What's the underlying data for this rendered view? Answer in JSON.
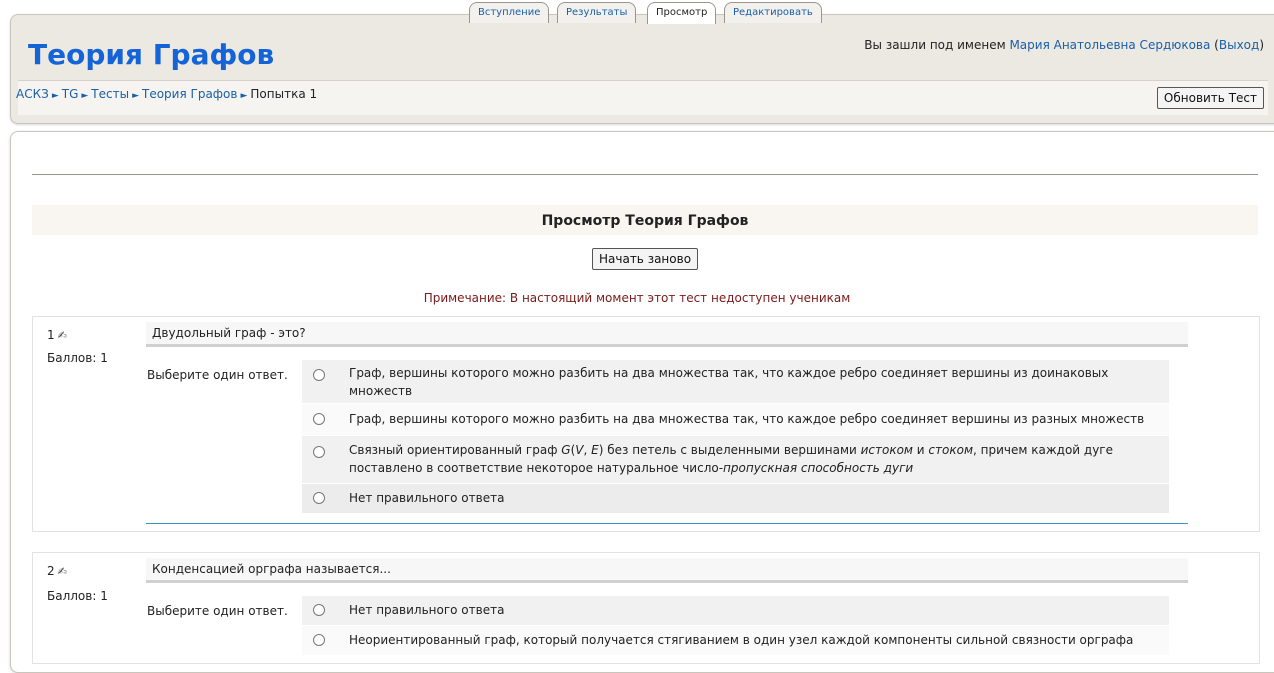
{
  "header": {
    "course_title": "Теория Графов",
    "login_prefix": "Вы зашли под именем ",
    "user_name": "Мария Анатольевна Сердюкова",
    "logout": "Выход",
    "breadcrumb": [
      "АСКЗ",
      "TG",
      "Тесты",
      "Теория Графов",
      "Попытка 1"
    ],
    "update_button": "Обновить Тест"
  },
  "tabs": [
    {
      "label": "Вступление",
      "active": false
    },
    {
      "label": "Результаты",
      "active": false
    },
    {
      "label": "Просмотр",
      "active": true
    },
    {
      "label": "Редактировать",
      "active": false
    }
  ],
  "preview": {
    "title": "Просмотр Теория Графов",
    "restart_button": "Начать заново",
    "note": "Примечание: В настоящий момент этот тест недоступен ученикам"
  },
  "questions": [
    {
      "number": "1",
      "score": "Баллов: 1",
      "text": "Двудольный граф - это?",
      "prompt": "Выберите один ответ.",
      "answers": [
        "Граф, вершины которого можно разбить на два множества так, что каждое ребро соединяет вершины из доинаковых множеств",
        "Граф, вершины которого можно разбить на два множества так, что каждое ребро соединяет вершины из разных множеств",
        "Связный ориентированный граф G(V, E) без петель с выделенными вершинами истоком и стоком, причем каждой дуге поставлено в соответствие некоторое натуральное число-пропускная способность дуги",
        "Нет правильного ответа"
      ]
    },
    {
      "number": "2",
      "score": "Баллов: 1",
      "text": "Конденсацией орграфа называется...",
      "prompt": "Выберите один ответ.",
      "answers": [
        "Нет правильного ответа",
        "Неориентированный граф, который получается стягиванием в один узел каждой компоненты сильной связности орграфа"
      ]
    }
  ]
}
